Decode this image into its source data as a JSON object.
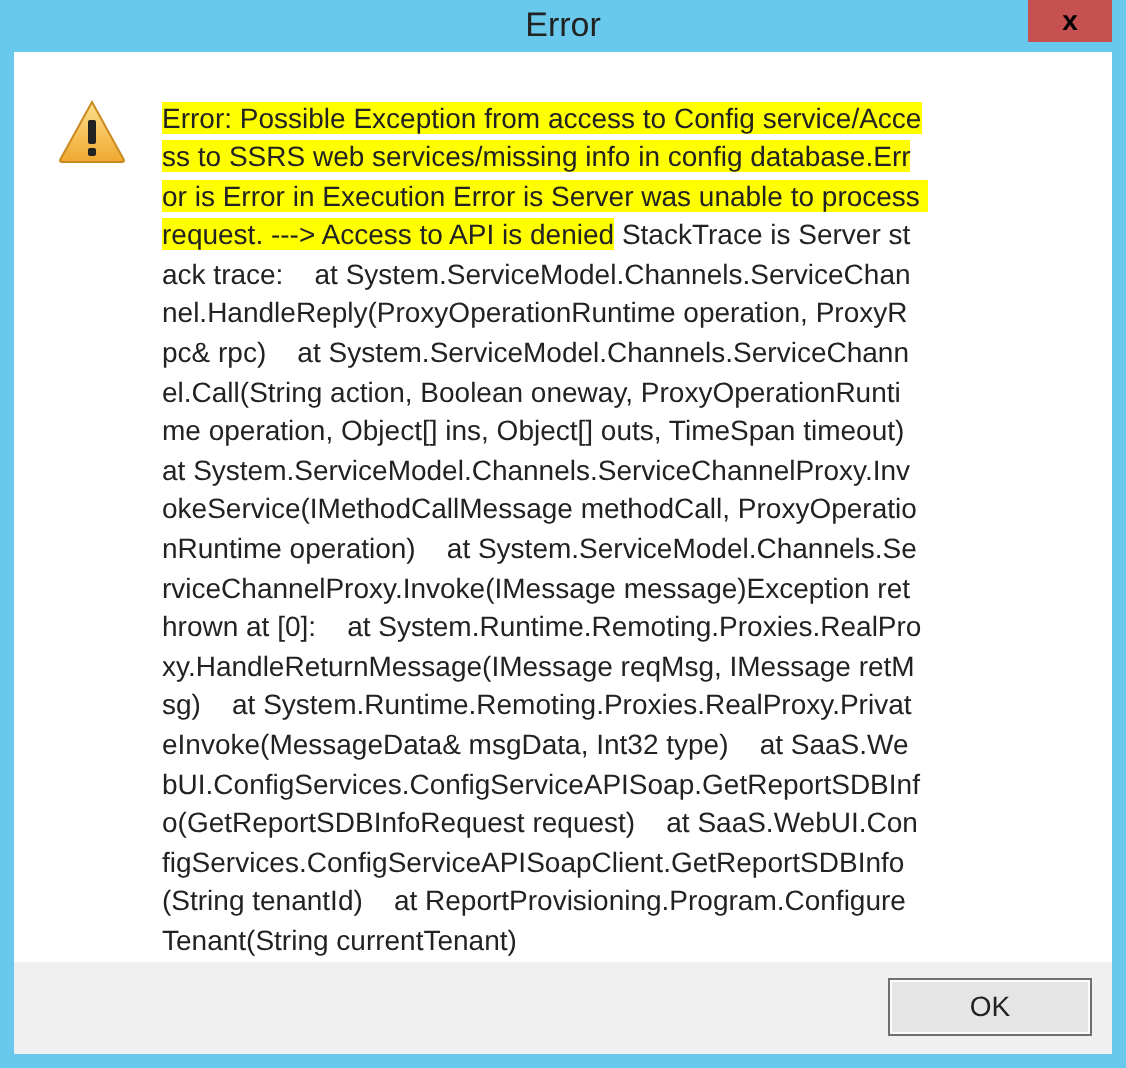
{
  "window": {
    "title": "Error",
    "close_label": "x"
  },
  "message": {
    "highlighted_part": "Error: Possible Exception from access to Config service/Access to SSRS web services/missing info in config database.Error is Error in Execution Error is Server was unable to process request. ---> Access to API is denied",
    "rest": " StackTrace is Server stack trace:    at System.ServiceModel.Channels.ServiceChannel.HandleReply(ProxyOperationRuntime operation, ProxyRpc& rpc)    at System.ServiceModel.Channels.ServiceChannel.Call(String action, Boolean oneway, ProxyOperationRuntime operation, Object[] ins, Object[] outs, TimeSpan timeout)    at System.ServiceModel.Channels.ServiceChannelProxy.InvokeService(IMethodCallMessage methodCall, ProxyOperationRuntime operation)    at System.ServiceModel.Channels.ServiceChannelProxy.Invoke(IMessage message)Exception rethrown at [0]:    at System.Runtime.Remoting.Proxies.RealProxy.HandleReturnMessage(IMessage reqMsg, IMessage retMsg)    at System.Runtime.Remoting.Proxies.RealProxy.PrivateInvoke(MessageData& msgData, Int32 type)    at SaaS.WebUI.ConfigServices.ConfigServiceAPISoap.GetReportSDBInfo(GetReportSDBInfoRequest request)    at SaaS.WebUI.ConfigServices.ConfigServiceAPISoapClient.GetReportSDBInfo(String tenantId)    at ReportProvisioning.Program.ConfigureTenant(String currentTenant)"
  },
  "buttons": [
    {
      "label": "OK"
    }
  ]
}
